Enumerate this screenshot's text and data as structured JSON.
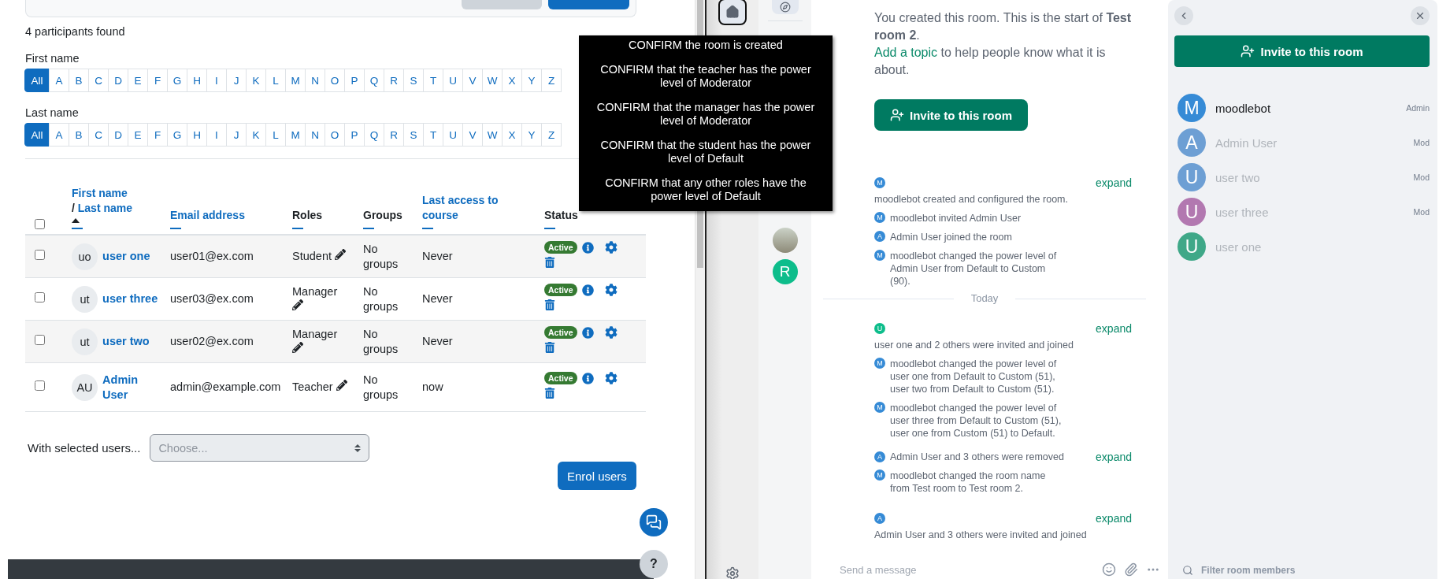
{
  "participants": {
    "found": "4 participants found",
    "initial_filters": [
      {
        "label": "First name",
        "letters": [
          {
            "label": "All",
            "selected": true
          },
          {
            "label": "A",
            "selected": false
          },
          {
            "label": "B",
            "selected": false
          },
          {
            "label": "C",
            "selected": false
          },
          {
            "label": "D",
            "selected": false
          },
          {
            "label": "E",
            "selected": false
          },
          {
            "label": "F",
            "selected": false
          },
          {
            "label": "G",
            "selected": false
          },
          {
            "label": "H",
            "selected": false
          },
          {
            "label": "I",
            "selected": false
          },
          {
            "label": "J",
            "selected": false
          },
          {
            "label": "K",
            "selected": false
          },
          {
            "label": "L",
            "selected": false
          },
          {
            "label": "M",
            "selected": false
          },
          {
            "label": "N",
            "selected": false
          },
          {
            "label": "O",
            "selected": false
          },
          {
            "label": "P",
            "selected": false
          },
          {
            "label": "Q",
            "selected": false
          },
          {
            "label": "R",
            "selected": false
          },
          {
            "label": "S",
            "selected": false
          },
          {
            "label": "T",
            "selected": false
          },
          {
            "label": "U",
            "selected": false
          },
          {
            "label": "V",
            "selected": false
          },
          {
            "label": "W",
            "selected": false
          },
          {
            "label": "X",
            "selected": false
          },
          {
            "label": "Y",
            "selected": false
          },
          {
            "label": "Z",
            "selected": false
          }
        ]
      },
      {
        "label": "Last name",
        "letters": [
          {
            "label": "All",
            "selected": true
          },
          {
            "label": "A",
            "selected": false
          },
          {
            "label": "B",
            "selected": false
          },
          {
            "label": "C",
            "selected": false
          },
          {
            "label": "D",
            "selected": false
          },
          {
            "label": "E",
            "selected": false
          },
          {
            "label": "F",
            "selected": false
          },
          {
            "label": "G",
            "selected": false
          },
          {
            "label": "H",
            "selected": false
          },
          {
            "label": "I",
            "selected": false
          },
          {
            "label": "J",
            "selected": false
          },
          {
            "label": "K",
            "selected": false
          },
          {
            "label": "L",
            "selected": false
          },
          {
            "label": "M",
            "selected": false
          },
          {
            "label": "N",
            "selected": false
          },
          {
            "label": "O",
            "selected": false
          },
          {
            "label": "P",
            "selected": false
          },
          {
            "label": "Q",
            "selected": false
          },
          {
            "label": "R",
            "selected": false
          },
          {
            "label": "S",
            "selected": false
          },
          {
            "label": "T",
            "selected": false
          },
          {
            "label": "U",
            "selected": false
          },
          {
            "label": "V",
            "selected": false
          },
          {
            "label": "W",
            "selected": false
          },
          {
            "label": "X",
            "selected": false
          },
          {
            "label": "Y",
            "selected": false
          },
          {
            "label": "Z",
            "selected": false
          }
        ]
      }
    ],
    "header_checked": false,
    "columns": [
      {
        "kind": "name",
        "label": "First name",
        "separator": "/",
        "second_label": "Last name",
        "sorted": true
      },
      {
        "kind": "link",
        "label": "Email address"
      },
      {
        "kind": "plain",
        "label": "Roles"
      },
      {
        "kind": "plain",
        "label": "Groups"
      },
      {
        "kind": "link",
        "label": "Last access to course"
      },
      {
        "kind": "plain",
        "label": "Status"
      }
    ],
    "rows": [
      {
        "initials": "uo",
        "name": "user one",
        "email": "user01@ex.com",
        "role": "Student",
        "groups": "No groups",
        "last_access": "Never",
        "status": "Active",
        "checked": false
      },
      {
        "initials": "ut",
        "name": "user three",
        "email": "user03@ex.com",
        "role": "Manager",
        "groups": "No groups",
        "last_access": "Never",
        "status": "Active",
        "checked": false
      },
      {
        "initials": "ut",
        "name": "user two",
        "email": "user02@ex.com",
        "role": "Manager",
        "groups": "No groups",
        "last_access": "Never",
        "status": "Active",
        "checked": false
      },
      {
        "initials": "AU",
        "name": "Admin User",
        "email": "admin@example.com",
        "role": "Teacher",
        "groups": "No groups",
        "last_access": "now",
        "status": "Active",
        "checked": false
      }
    ],
    "bulk": {
      "label": "With selected users...",
      "placeholder": "Choose..."
    },
    "enrol_button": "Enrol users",
    "help_button": "?"
  },
  "tooltip": {
    "lines": [
      "CONFIRM the room is created",
      "CONFIRM that the teacher has the power level of Moderator",
      "CONFIRM that the manager has the power level of Moderator",
      "CONFIRM that the student has the power level of Default",
      "CONFIRM that any other roles have the power level of Default"
    ]
  },
  "spaces": [
    {
      "kind": "home",
      "selected": true
    },
    {
      "kind": "explore",
      "selected": false
    }
  ],
  "rooms": [
    {
      "kind": "photo"
    },
    {
      "kind": "letter",
      "letter": "R",
      "color": "#0dbd8b"
    }
  ],
  "timeline": {
    "intro": "You created this room. This is the start of **Test room 2**.",
    "topic_link": "Add a topic",
    "topic_rest": "to help people know what it is about.",
    "invite_button": "Invite to this room",
    "events": [
      {
        "kind": "group",
        "letter": "M",
        "color": "#368bd6",
        "expand": "expand",
        "summary": "moodlebot created and configured the room."
      },
      {
        "kind": "event",
        "letter": "M",
        "color": "#368bd6",
        "text": "moodlebot invited Admin User"
      },
      {
        "kind": "event",
        "letter": "A",
        "color": "#368bd6",
        "text": "Admin User joined the room"
      },
      {
        "kind": "event",
        "letter": "M",
        "color": "#368bd6",
        "text": "moodlebot changed the power level of\nAdmin User from Default to Custom\n(90)."
      },
      {
        "kind": "separator",
        "label": "Today"
      },
      {
        "kind": "group",
        "letter": "U",
        "color": "#0dbd8b",
        "expand": "expand",
        "summary": "user one and 2 others were invited and joined"
      },
      {
        "kind": "event",
        "letter": "M",
        "color": "#368bd6",
        "text": "moodlebot changed the power level of\nuser one from Default to Custom (51),\nuser two from Default to Custom (51)."
      },
      {
        "kind": "event",
        "letter": "M",
        "color": "#368bd6",
        "text": "moodlebot changed the power level of\nuser three from Default to Custom (51),\nuser one from Custom (51) to Default."
      },
      {
        "kind": "inline_group",
        "letter": "A",
        "color": "#368bd6",
        "expand": "expand",
        "summary": "Admin User and 3 others were removed"
      },
      {
        "kind": "event",
        "letter": "M",
        "color": "#368bd6",
        "text": "moodlebot changed the room name\nfrom Test room to Test room 2."
      },
      {
        "kind": "group",
        "letter": "A",
        "color": "#368bd6",
        "expand": "expand",
        "summary": "Admin User and 3 others were invited and joined"
      }
    ]
  },
  "composer": {
    "placeholder": "Send a message"
  },
  "members_panel": {
    "invite_button": "Invite to this room",
    "members": [
      {
        "letter": "M",
        "name": "moodlebot",
        "role": "Admin",
        "color": "#368bd6",
        "invited": false
      },
      {
        "letter": "A",
        "name": "Admin User",
        "role": "Mod",
        "color": "#6d9fd4",
        "invited": true
      },
      {
        "letter": "U",
        "name": "user two",
        "role": "Mod",
        "color": "#6d9fd4",
        "invited": true
      },
      {
        "letter": "U",
        "name": "user three",
        "role": "Mod",
        "color": "#b278b0",
        "invited": true
      },
      {
        "letter": "U",
        "name": "user one",
        "color": "#3fa888",
        "invited": true
      }
    ],
    "filter_placeholder": "Filter room members"
  }
}
